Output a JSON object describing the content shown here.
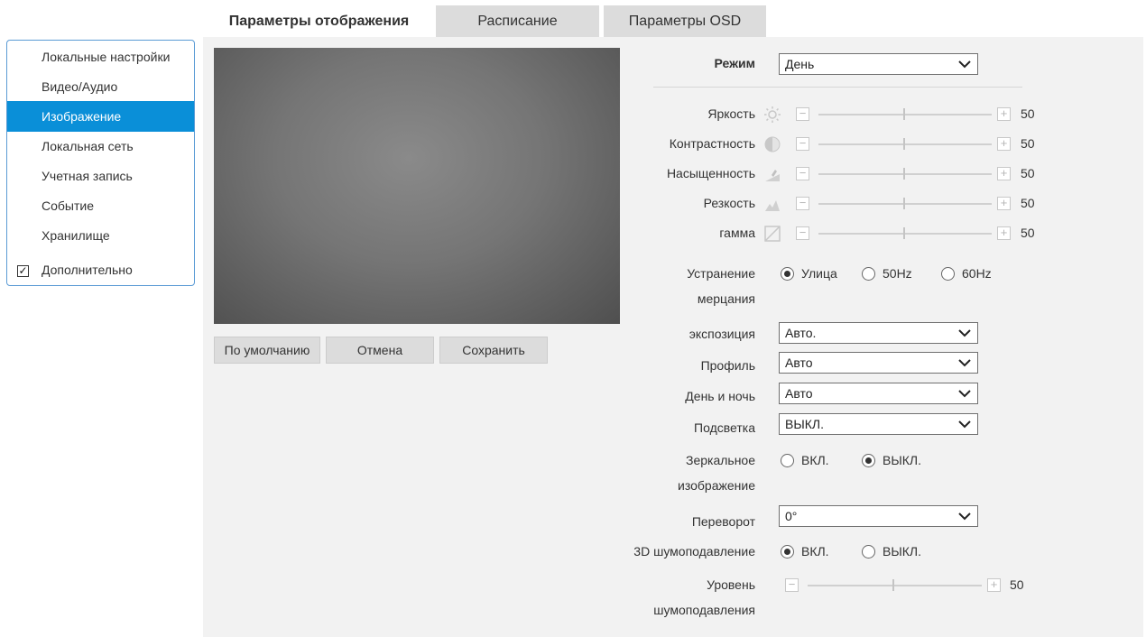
{
  "tabs": [
    {
      "label": "Параметры отображения"
    },
    {
      "label": "Расписание"
    },
    {
      "label": "Параметры OSD"
    }
  ],
  "sidebar": {
    "items": [
      {
        "label": "Локальные настройки"
      },
      {
        "label": "Видео/Аудио"
      },
      {
        "label": "Изображение"
      },
      {
        "label": "Локальная сеть"
      },
      {
        "label": "Учетная запись"
      },
      {
        "label": "Событие"
      },
      {
        "label": "Хранилище"
      },
      {
        "label": "Дополнительно"
      }
    ],
    "check_glyph": "✓"
  },
  "buttons": {
    "default": "По умолчанию",
    "cancel": "Отмена",
    "save": "Сохранить"
  },
  "mode": {
    "label": "Режим",
    "value": "День"
  },
  "sliders": [
    {
      "label": "Яркость",
      "icon": "brightness-icon",
      "value": "50"
    },
    {
      "label": "Контрастность",
      "icon": "contrast-icon",
      "value": "50"
    },
    {
      "label": "Насыщенность",
      "icon": "saturation-icon",
      "value": "50"
    },
    {
      "label": "Резкость",
      "icon": "sharpness-icon",
      "value": "50"
    },
    {
      "label": "гамма",
      "icon": "gamma-icon",
      "value": "50"
    }
  ],
  "slider_minus": "−",
  "slider_plus": "+",
  "flicker": {
    "label_line1": "Устранение",
    "label_line2": "мерцания",
    "options": [
      "Улица",
      "50Hz",
      "60Hz"
    ],
    "selected": "Улица"
  },
  "exposure": {
    "label": "экспозиция",
    "value": "Авто."
  },
  "profile": {
    "label": "Профиль",
    "value": "Авто"
  },
  "daynight": {
    "label": "День и ночь",
    "value": "Авто"
  },
  "backlight": {
    "label": "Подсветка",
    "value": "ВЫКЛ."
  },
  "mirror": {
    "label_line1": "Зеркальное",
    "label_line2": "изображение",
    "options": [
      "ВКЛ.",
      "ВЫКЛ."
    ],
    "selected": "ВЫКЛ."
  },
  "flip": {
    "label": "Переворот",
    "value": "0°"
  },
  "dnr3d": {
    "label": "3D шумоподавление",
    "options": [
      "ВКЛ.",
      "ВЫКЛ."
    ],
    "selected": "ВКЛ."
  },
  "dnr_level": {
    "label_line1": "Уровень",
    "label_line2": "шумоподавления",
    "value": "50"
  },
  "colors": {
    "accent": "#0a8fd8",
    "panel": "#f2f2f2",
    "tab_inactive": "#dcdcdc"
  }
}
